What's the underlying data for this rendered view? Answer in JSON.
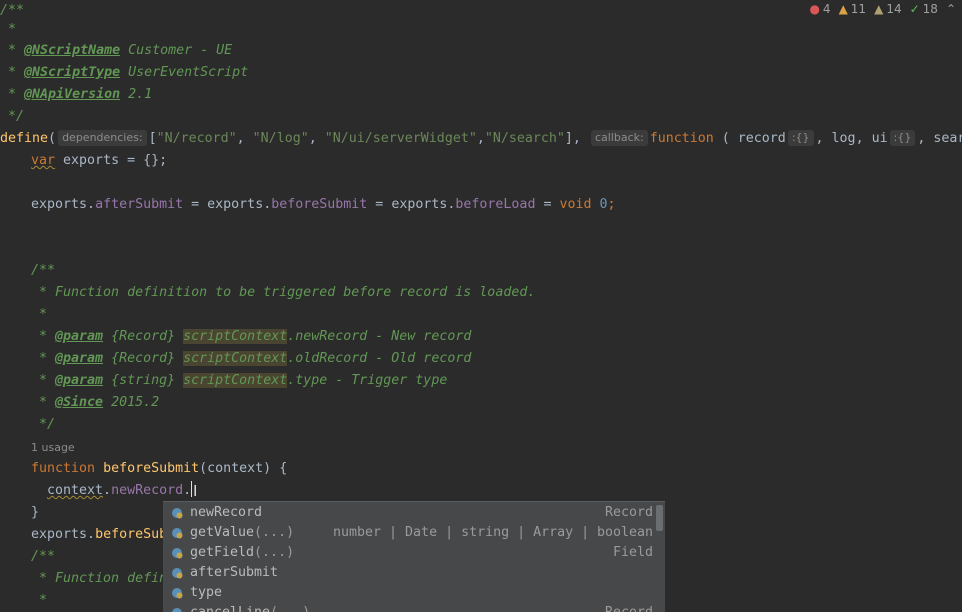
{
  "status": {
    "errors": "4",
    "warnings": "11",
    "weak_warnings": "14",
    "ok": "18"
  },
  "code": {
    "l1": "/**",
    "l2": " *",
    "l3_tag": "@NScriptName",
    "l3_val": " Customer - UE",
    "l4_tag": "@NScriptType",
    "l4_val": " UserEventScript",
    "l5_tag": "@NApiVersion",
    "l5_val": " 2.1",
    "l6": " */",
    "define": "define",
    "hint_dependencies": "dependencies:",
    "deps": [
      "\"N/record\"",
      "\"N/log\"",
      "\"N/ui/serverWidget\"",
      "\"N/search\""
    ],
    "hint_callback": "callback:",
    "function_kw": "function",
    "param_record": "record",
    "param_hint": ":{}",
    "param_log": "log",
    "param_ui": "ui",
    "param_search": "searc",
    "var_kw": "var",
    "exports_decl": " exports = {};",
    "exports_line": [
      "exports",
      "afterSubmit",
      "exports",
      "beforeSubmit",
      "exports",
      "beforeLoad",
      "void",
      "0"
    ],
    "doc_open": "/**",
    "doc_desc": " * Function definition to be triggered before record is loaded.",
    "doc_star": " *",
    "param_tag": "@param",
    "doc_p1_type": " {Record} ",
    "doc_p1_ctx": "scriptContext",
    "doc_p1_rest": ".newRecord - New record",
    "doc_p2_type": " {Record} ",
    "doc_p2_ctx": "scriptContext",
    "doc_p2_rest": ".oldRecord - Old record",
    "doc_p3_type": " {string} ",
    "doc_p3_ctx": "scriptContext",
    "doc_p3_rest": ".type - Trigger type",
    "since_tag": "@Since",
    "since_val": " 2015.2",
    "doc_close": " */",
    "usage": "1 usage",
    "fn_name": "beforeSubmit",
    "fn_params": "(context) {",
    "ctx": "context",
    "new_record": "newRecord",
    "close_brace": "}",
    "exports_before": "exports",
    "before_sub_partial": "beforeSub",
    "doc2_open": "/**",
    "doc2_desc": " * Function defin",
    "doc2_star": " *"
  },
  "completion": {
    "items": [
      {
        "name": "newRecord",
        "sig": "",
        "type": "Record",
        "mid": ""
      },
      {
        "name": "getValue",
        "sig": "(...)",
        "type": "boolean",
        "mid": "number | Date | string | Array |"
      },
      {
        "name": "getField",
        "sig": "(...)",
        "type": "Field",
        "mid": ""
      },
      {
        "name": "afterSubmit",
        "sig": "",
        "type": "",
        "mid": ""
      },
      {
        "name": "type",
        "sig": "",
        "type": "",
        "mid": ""
      },
      {
        "name": "cancelLine",
        "sig": "(...)",
        "type": "Record",
        "mid": ""
      }
    ]
  },
  "colors": {
    "background": "#2b2b2b",
    "keyword": "#cc7832",
    "string": "#6a8759",
    "doc": "#629755",
    "popup": "#46484a"
  }
}
